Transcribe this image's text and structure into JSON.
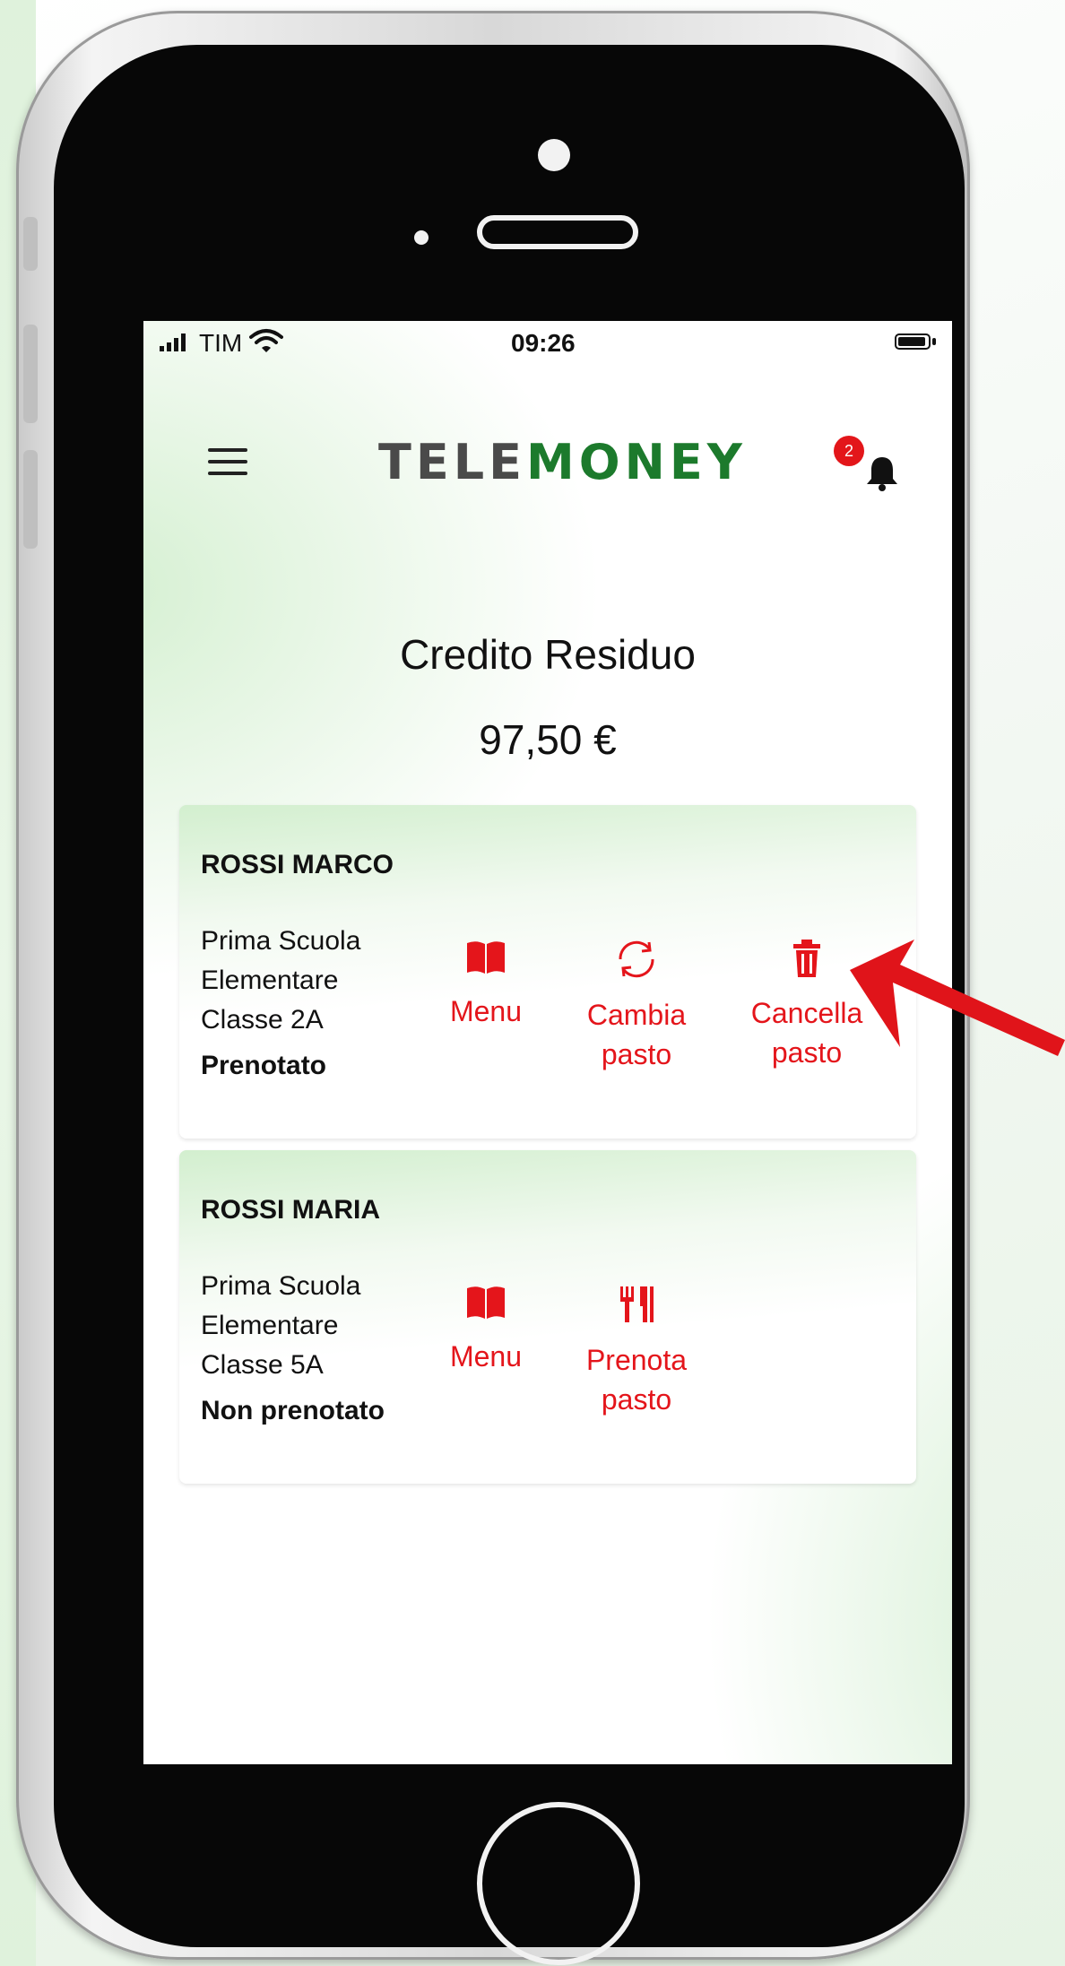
{
  "status_bar": {
    "carrier": "TIM",
    "time": "09:26"
  },
  "header": {
    "logo_part1": "TELE",
    "logo_part2": "MONEY",
    "notification_count": "2"
  },
  "credit": {
    "label": "Credito Residuo",
    "value": "97,50 €"
  },
  "children": [
    {
      "name": "ROSSI MARCO",
      "school_line1": "Prima Scuola",
      "school_line2": "Elementare",
      "class": "Classe 2A",
      "status": "Prenotato",
      "actions": [
        {
          "icon": "book-icon",
          "line1": "Menu",
          "line2": ""
        },
        {
          "icon": "refresh-icon",
          "line1": "Cambia",
          "line2": "pasto"
        },
        {
          "icon": "trash-icon",
          "line1": "Cancella",
          "line2": "pasto"
        }
      ]
    },
    {
      "name": "ROSSI MARIA",
      "school_line1": "Prima Scuola",
      "school_line2": "Elementare",
      "class": "Classe 5A",
      "status": "Non prenotato",
      "actions": [
        {
          "icon": "book-icon",
          "line1": "Menu",
          "line2": ""
        },
        {
          "icon": "fork-knife-icon",
          "line1": "Prenota",
          "line2": "pasto"
        }
      ]
    }
  ],
  "colors": {
    "accent": "#e4151b",
    "brand_green": "#1c7a2c",
    "arrow_annotation": "#e0141a"
  }
}
